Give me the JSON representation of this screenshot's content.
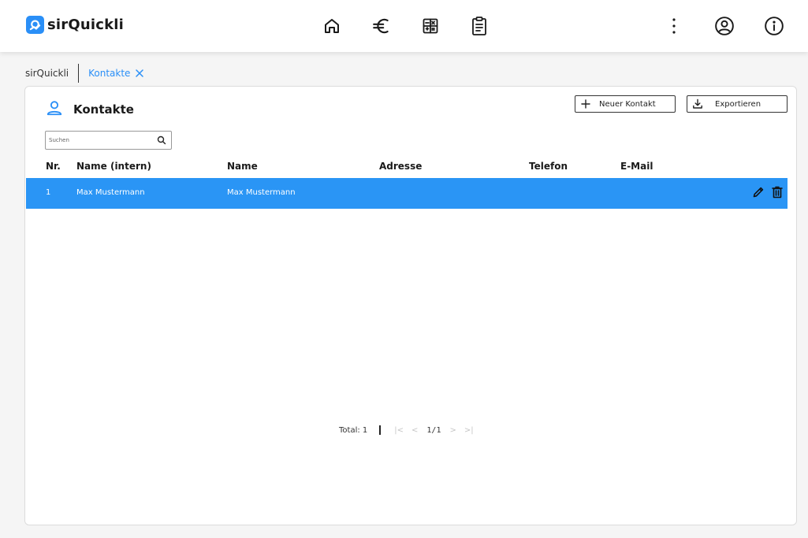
{
  "app": {
    "name": "sirQuickli"
  },
  "colors": {
    "accent": "#2a8ff7",
    "row_selected": "#2a95f5"
  },
  "topnav": {
    "icons": [
      "home-icon",
      "euro-icon",
      "calculator-icon",
      "clipboard-icon"
    ],
    "right_icons": [
      "more-vertical-icon",
      "user-circle-icon",
      "info-icon"
    ]
  },
  "tabs": {
    "root": "sirQuickli",
    "active": "Kontakte"
  },
  "page": {
    "title": "Kontakte",
    "new_button": "Neuer Kontakt",
    "export_button": "Exportieren",
    "search_placeholder": "Suchen"
  },
  "table": {
    "columns": [
      "Nr.",
      "Name (intern)",
      "Name",
      "Adresse",
      "Telefon",
      "E-Mail"
    ],
    "rows": [
      {
        "nr": "1",
        "name_intern": "Max Mustermann",
        "name": "Max Mustermann",
        "adresse": "",
        "telefon": "",
        "email": ""
      }
    ]
  },
  "pagination": {
    "total": "Total: 1",
    "pages": "1/1"
  }
}
